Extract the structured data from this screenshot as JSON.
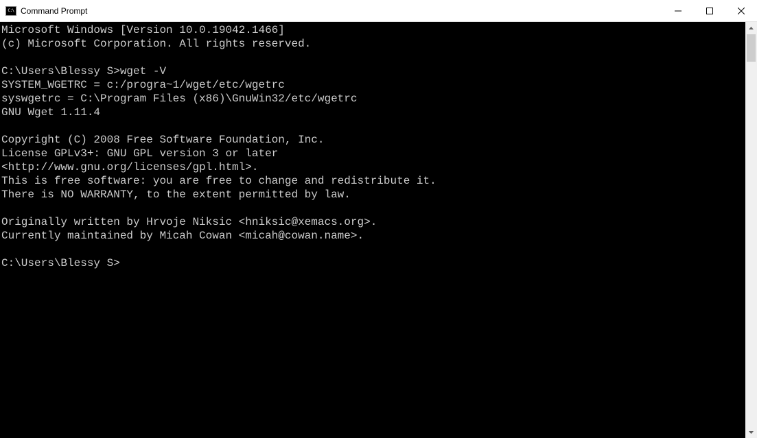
{
  "window": {
    "title": "Command Prompt"
  },
  "terminal": {
    "lines": [
      "Microsoft Windows [Version 10.0.19042.1466]",
      "(c) Microsoft Corporation. All rights reserved.",
      "",
      "C:\\Users\\Blessy S>wget -V",
      "SYSTEM_WGETRC = c:/progra~1/wget/etc/wgetrc",
      "syswgetrc = C:\\Program Files (x86)\\GnuWin32/etc/wgetrc",
      "GNU Wget 1.11.4",
      "",
      "Copyright (C) 2008 Free Software Foundation, Inc.",
      "License GPLv3+: GNU GPL version 3 or later",
      "<http://www.gnu.org/licenses/gpl.html>.",
      "This is free software: you are free to change and redistribute it.",
      "There is NO WARRANTY, to the extent permitted by law.",
      "",
      "Originally written by Hrvoje Niksic <hniksic@xemacs.org>.",
      "Currently maintained by Micah Cowan <micah@cowan.name>.",
      "",
      "C:\\Users\\Blessy S>"
    ]
  }
}
